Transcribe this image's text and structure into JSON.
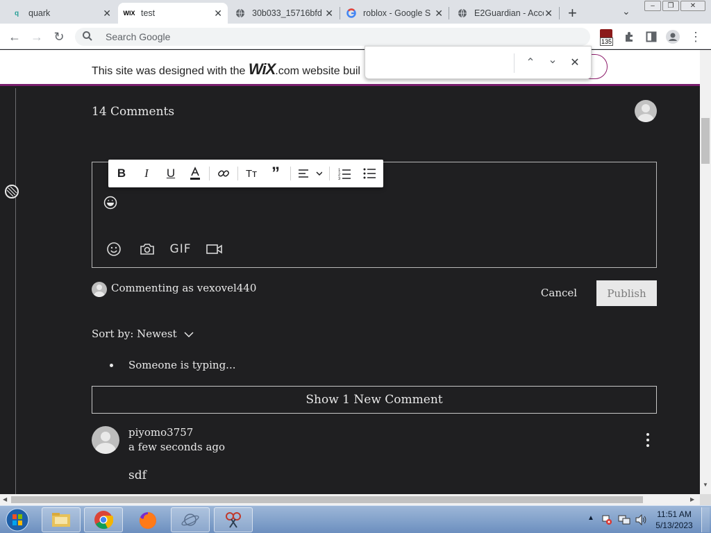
{
  "browser": {
    "tabs": [
      {
        "title": "quark",
        "icon": "q-icon"
      },
      {
        "title": "test",
        "icon": "wix-icon",
        "active": true
      },
      {
        "title": "30b033_15716bfd",
        "icon": "globe-icon"
      },
      {
        "title": "roblox - Google S",
        "icon": "google-icon"
      },
      {
        "title": "E2Guardian - Acce",
        "icon": "globe-icon"
      }
    ],
    "omnibox_placeholder": "Search Google",
    "extension_badge": "135"
  },
  "wix_banner": {
    "prefix": "This site was designed with the",
    "brand": "WiX",
    "suffix": ".com website buil"
  },
  "comments": {
    "title": "14 Comments",
    "commenting_as": "Commenting as vexovel440",
    "cancel_label": "Cancel",
    "publish_label": "Publish",
    "sort_label": "Sort by: Newest",
    "typing_text": "Someone is typing...",
    "show_new_label": "Show 1 New Comment",
    "gif_label": "GIF",
    "items": [
      {
        "user": "piyomo3757",
        "time": "a few seconds ago",
        "body": "sdf"
      }
    ]
  },
  "taskbar": {
    "time": "11:51 AM",
    "date": "5/13/2023"
  },
  "colors": {
    "page_bg": "#1f1f21",
    "wix_border": "#7a1f6e",
    "publish_bg": "#e8e8e8"
  }
}
